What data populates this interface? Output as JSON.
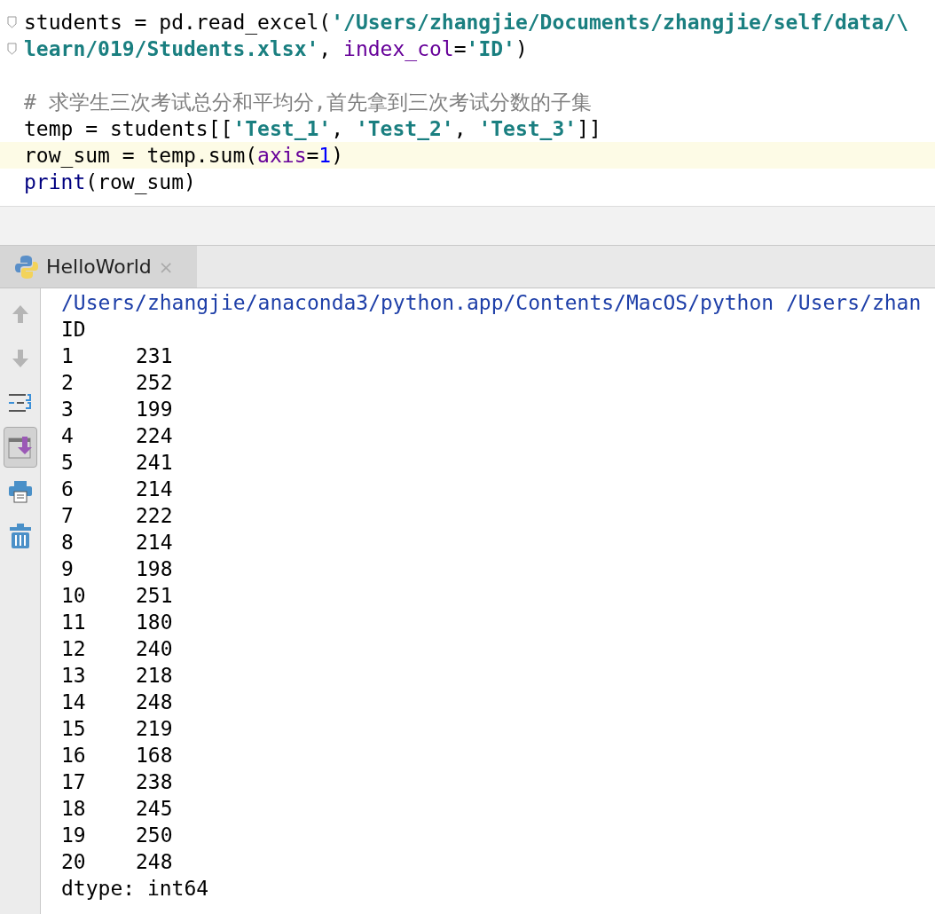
{
  "editor": {
    "lines": [
      {
        "current": false,
        "fold": true,
        "tokens": [
          {
            "kind": "plain",
            "text": "students = pd.read_excel("
          },
          {
            "kind": "string",
            "text": "'/Users/zhangjie/Documents/zhangjie/self/data/\\"
          }
        ]
      },
      {
        "current": false,
        "fold": true,
        "tokens": [
          {
            "kind": "string",
            "text": "learn/019/Students.xlsx'"
          },
          {
            "kind": "plain",
            "text": ", "
          },
          {
            "kind": "param",
            "text": "index_col"
          },
          {
            "kind": "plain",
            "text": "="
          },
          {
            "kind": "string",
            "text": "'ID'"
          },
          {
            "kind": "plain",
            "text": ")"
          }
        ]
      },
      {
        "current": false,
        "fold": false
      },
      {
        "current": false,
        "fold": false,
        "tokens": [
          {
            "kind": "comment",
            "text": "# 求学生三次考试总分和平均分,首先拿到三次考试分数的子集"
          }
        ]
      },
      {
        "current": false,
        "fold": false,
        "tokens": [
          {
            "kind": "plain",
            "text": "temp = students[["
          },
          {
            "kind": "string",
            "text": "'Test_1'"
          },
          {
            "kind": "plain",
            "text": ", "
          },
          {
            "kind": "string",
            "text": "'Test_2'"
          },
          {
            "kind": "plain",
            "text": ", "
          },
          {
            "kind": "string",
            "text": "'Test_3'"
          },
          {
            "kind": "plain",
            "text": "]]"
          }
        ]
      },
      {
        "current": true,
        "fold": false,
        "tokens": [
          {
            "kind": "plain",
            "text": "row_sum = temp.sum("
          },
          {
            "kind": "param",
            "text": "axis"
          },
          {
            "kind": "plain",
            "text": "="
          },
          {
            "kind": "number",
            "text": "1"
          },
          {
            "kind": "plain",
            "text": ")"
          }
        ]
      },
      {
        "current": false,
        "fold": false,
        "tokens": [
          {
            "kind": "builtin",
            "text": "print"
          },
          {
            "kind": "plain",
            "text": "(row_sum)"
          }
        ]
      }
    ]
  },
  "run_tab": {
    "title": "HelloWorld",
    "close": "×",
    "selected": true
  },
  "toolbar": [
    {
      "kind": "up",
      "selected": false
    },
    {
      "kind": "down",
      "selected": false
    },
    {
      "kind": "wrap",
      "selected": false
    },
    {
      "kind": "scroll-end",
      "selected": true
    },
    {
      "kind": "print",
      "selected": false
    },
    {
      "kind": "trash",
      "selected": false
    }
  ],
  "console": {
    "command": "/Users/zhangjie/anaconda3/python.app/Contents/MacOS/python /Users/zhan",
    "header": "ID",
    "rows": [
      {
        "id": "1",
        "value": "231"
      },
      {
        "id": "2",
        "value": "252"
      },
      {
        "id": "3",
        "value": "199"
      },
      {
        "id": "4",
        "value": "224"
      },
      {
        "id": "5",
        "value": "241"
      },
      {
        "id": "6",
        "value": "214"
      },
      {
        "id": "7",
        "value": "222"
      },
      {
        "id": "8",
        "value": "214"
      },
      {
        "id": "9",
        "value": "198"
      },
      {
        "id": "10",
        "value": "251"
      },
      {
        "id": "11",
        "value": "180"
      },
      {
        "id": "12",
        "value": "240"
      },
      {
        "id": "13",
        "value": "218"
      },
      {
        "id": "14",
        "value": "248"
      },
      {
        "id": "15",
        "value": "219"
      },
      {
        "id": "16",
        "value": "168"
      },
      {
        "id": "17",
        "value": "238"
      },
      {
        "id": "18",
        "value": "245"
      },
      {
        "id": "19",
        "value": "250"
      },
      {
        "id": "20",
        "value": "248"
      }
    ],
    "footer": "dtype: int64"
  }
}
